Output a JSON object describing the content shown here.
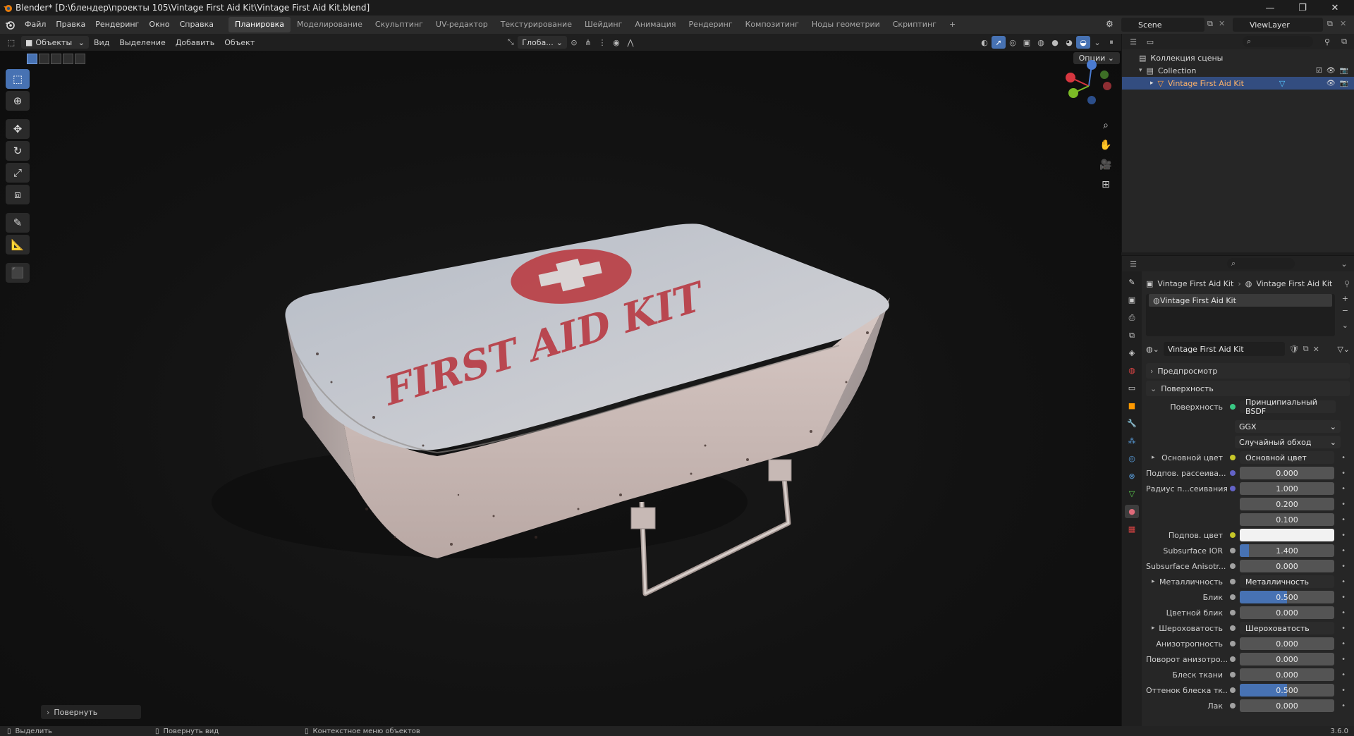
{
  "window": {
    "title": "Blender* [D:\\блендер\\проекты 105\\Vintage First Aid Kit\\Vintage First Aid Kit.blend]",
    "controls": [
      "—",
      "❐",
      "✕"
    ]
  },
  "menu": [
    "Файл",
    "Правка",
    "Рендеринг",
    "Окно",
    "Справка"
  ],
  "workspaces": {
    "tabs": [
      "Планировка",
      "Моделирование",
      "Скульптинг",
      "UV-редактор",
      "Текстурирование",
      "Шейдинг",
      "Анимация",
      "Рендеринг",
      "Композитинг",
      "Ноды геометрии",
      "Скриптинг"
    ],
    "active": "Планировка",
    "add": "+"
  },
  "scene": {
    "name": "Scene",
    "view_layer": "ViewLayer"
  },
  "viewport_header": {
    "mode": "Объекты",
    "menus": [
      "Вид",
      "Выделение",
      "Добавить",
      "Объект"
    ],
    "orientation": "Глоба...",
    "options": "Опции"
  },
  "viewport": {
    "object_text": "FIRST AID KIT",
    "operator_panel": "Повернуть"
  },
  "outliner": {
    "rows": [
      {
        "label": "Коллекция сцены",
        "level": 0
      },
      {
        "label": "Collection",
        "level": 1
      },
      {
        "label": "Vintage First Aid Kit",
        "level": 2,
        "selected": true
      }
    ]
  },
  "properties": {
    "breadcrumb": [
      "Vintage First Aid Kit",
      "Vintage First Aid Kit"
    ],
    "slot": "Vintage First Aid Kit",
    "material_name": "Vintage First Aid Kit",
    "panels": {
      "preview": "Предпросмотр",
      "surface": "Поверхность"
    },
    "surface": {
      "label": "Поверхность",
      "shader": "Принципиальный BSDF",
      "distribution": "GGX",
      "subsurface_method": "Случайный обход"
    },
    "rows": [
      {
        "label": "Основной цвет",
        "type": "link",
        "value": "Основной цвет",
        "socket": "#c7c729",
        "expander": true
      },
      {
        "label": "Подпов. рассеива...",
        "type": "num",
        "value": "0.000",
        "socket": "#6363c7",
        "fill": 0
      },
      {
        "label": "Радиус п...сеивания",
        "type": "num",
        "value": "1.000",
        "socket": "#6363c7",
        "fill": 0
      },
      {
        "label": "",
        "type": "num",
        "value": "0.200",
        "fill": 0
      },
      {
        "label": "",
        "type": "num",
        "value": "0.100",
        "fill": 0
      },
      {
        "label": "Подпов. цвет",
        "type": "color",
        "value": "",
        "socket": "#c7c729"
      },
      {
        "label": "Subsurface IOR",
        "type": "num",
        "value": "1.400",
        "socket": "#a1a1a1",
        "fill": 0.1
      },
      {
        "label": "Subsurface Anisotr...",
        "type": "num",
        "value": "0.000",
        "socket": "#a1a1a1",
        "fill": 0
      },
      {
        "label": "Металличность",
        "type": "link",
        "value": "Металличность",
        "socket": "#a1a1a1",
        "expander": true
      },
      {
        "label": "Блик",
        "type": "num",
        "value": "0.500",
        "socket": "#a1a1a1",
        "fill": 0.5
      },
      {
        "label": "Цветной блик",
        "type": "num",
        "value": "0.000",
        "socket": "#a1a1a1",
        "fill": 0
      },
      {
        "label": "Шероховатость",
        "type": "link",
        "value": "Шероховатость",
        "socket": "#a1a1a1",
        "expander": true
      },
      {
        "label": "Анизотропность",
        "type": "num",
        "value": "0.000",
        "socket": "#a1a1a1",
        "fill": 0
      },
      {
        "label": "Поворот анизотро...",
        "type": "num",
        "value": "0.000",
        "socket": "#a1a1a1",
        "fill": 0
      },
      {
        "label": "Блеск ткани",
        "type": "num",
        "value": "0.000",
        "socket": "#a1a1a1",
        "fill": 0
      },
      {
        "label": "Оттенок блеска тк...",
        "type": "num",
        "value": "0.500",
        "socket": "#a1a1a1",
        "fill": 0.5
      },
      {
        "label": "Лак",
        "type": "num",
        "value": "0.000",
        "socket": "#a1a1a1",
        "fill": 0
      }
    ]
  },
  "statusbar": {
    "select": "Выделить",
    "rotate_view": "Повернуть вид",
    "context_menu": "Контекстное меню объектов",
    "version": "3.6.0"
  },
  "colors": {
    "accent": "#4772b3",
    "selected_row": "#334d80",
    "object_highlight": "#ffa64d"
  }
}
